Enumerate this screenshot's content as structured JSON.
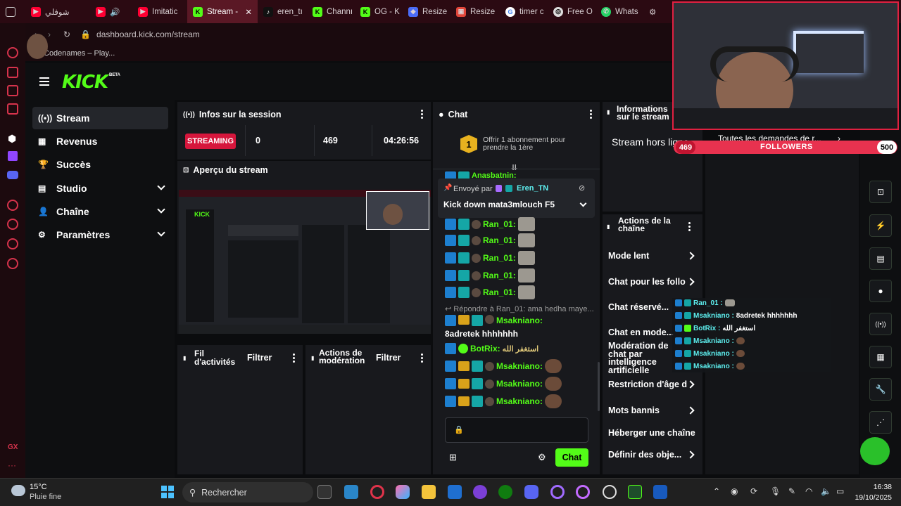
{
  "browser": {
    "tabs": [
      {
        "label": "",
        "icon": "devtools-icon"
      },
      {
        "label": "شوفلي",
        "icon": "youtube-icon"
      },
      {
        "label": "",
        "icon": "youtube-audio-icon"
      },
      {
        "label": "Imitatic",
        "icon": "youtube-icon"
      },
      {
        "label": "Stream -",
        "icon": "kick-icon",
        "active": true
      },
      {
        "label": "eren_tı",
        "icon": "tiktok-icon"
      },
      {
        "label": "Channı",
        "icon": "kick-icon"
      },
      {
        "label": "OG - K",
        "icon": "kick-icon"
      },
      {
        "label": "Resize",
        "icon": "resize-icon"
      },
      {
        "label": "Resize",
        "icon": "resize-icon"
      },
      {
        "label": "timer c",
        "icon": "google-icon"
      },
      {
        "label": "Free O",
        "icon": "free-icon"
      },
      {
        "label": "Whats",
        "icon": "whatsapp-icon"
      }
    ],
    "url": "dashboard.kick.com/stream",
    "bookmark": "Codenames – Play..."
  },
  "kick": {
    "logo": "KICK",
    "logo_badge": "BETA",
    "nav": [
      {
        "label": "Stream",
        "active": true
      },
      {
        "label": "Revenus"
      },
      {
        "label": "Succès"
      },
      {
        "label": "Studio",
        "expandable": true
      },
      {
        "label": "Chaîne",
        "expandable": true
      },
      {
        "label": "Paramètres",
        "expandable": true
      }
    ],
    "session": {
      "title": "Infos sur la session",
      "status": "STREAMING",
      "viewers": "0",
      "followers": "469",
      "duration": "04:26:56"
    },
    "preview": {
      "title": "Aperçu du stream"
    },
    "activity": {
      "title": "Fil d'activités",
      "filter": "Filtrer"
    },
    "moderation": {
      "title": "Actions de modération",
      "filter": "Filtrer"
    },
    "chat": {
      "title": "Chat",
      "sub_offer": "Offrir 1 abonnement pour prendre la 1ère",
      "sub_count": "1",
      "pinned_by_label": "Envoyé par",
      "pinned_by": "Eren_TN",
      "pinned_message": "Kick down mata3mlouch F5",
      "top_user": "Anasbatnin:",
      "ran_rows": [
        "Ran_01:",
        "Ran_01:",
        "Ran_01:",
        "Ran_01:",
        "Ran_01:"
      ],
      "reply_hint": "Répondre à Ran_01: ama hedha maye...",
      "msg1_user": "Msakniano:",
      "msg1_text": "8adretek hhhhhhh",
      "msg2_user": "BotRix:",
      "msg2_text": "استغفر الله",
      "msak_rows": [
        "Msakniano:",
        "Msakniano:",
        "Msakniano:"
      ],
      "send_button": "Chat"
    },
    "stream_info": {
      "title": "Informations sur le stream",
      "status": "Stream hors ligne"
    },
    "channel_actions": {
      "title": "Actions de la chaîne",
      "items": [
        {
          "label": "Mode lent",
          "chevron": true
        },
        {
          "label": "Chat pour les follo",
          "chevron": true
        },
        {
          "label": "Chat réservé...",
          "chevron": false
        },
        {
          "label": "Chat en mode...",
          "chevron": false
        },
        {
          "label": "Modération de chat par intelligence artificielle",
          "chevron": false
        },
        {
          "label": "Restriction d'âge d",
          "chevron": true
        },
        {
          "label": "Mots bannis",
          "chevron": true
        },
        {
          "label": "Héberger une chaîne",
          "chevron": false
        },
        {
          "label": "Définir des obje...",
          "chevron": true
        }
      ]
    }
  },
  "overlay": {
    "followers_label": "FOLLOWERS",
    "followers_current": "469",
    "followers_goal": "500",
    "followers_progress": 0.938,
    "requests_text": "Toutes les demandes de r...",
    "mini_chat": [
      {
        "user": "Ran_01 :",
        "text": ""
      },
      {
        "user": "Msakniano :",
        "text": "8adretek hhhhhhh"
      },
      {
        "user": "BotRix :",
        "text": "استغفر الله"
      },
      {
        "user": "Msakniano :",
        "text": ""
      },
      {
        "user": "Msakniano :",
        "text": ""
      },
      {
        "user": "Msakniano :",
        "text": ""
      }
    ]
  },
  "taskbar": {
    "weather_temp": "15°C",
    "weather_desc": "Pluie fine",
    "search": "Rechercher",
    "time": "16:38",
    "date": "19/10/2025"
  },
  "colors": {
    "kick_green": "#53fc18",
    "streaming_red": "#d6163c",
    "tab_bar": "#2b0a12"
  }
}
